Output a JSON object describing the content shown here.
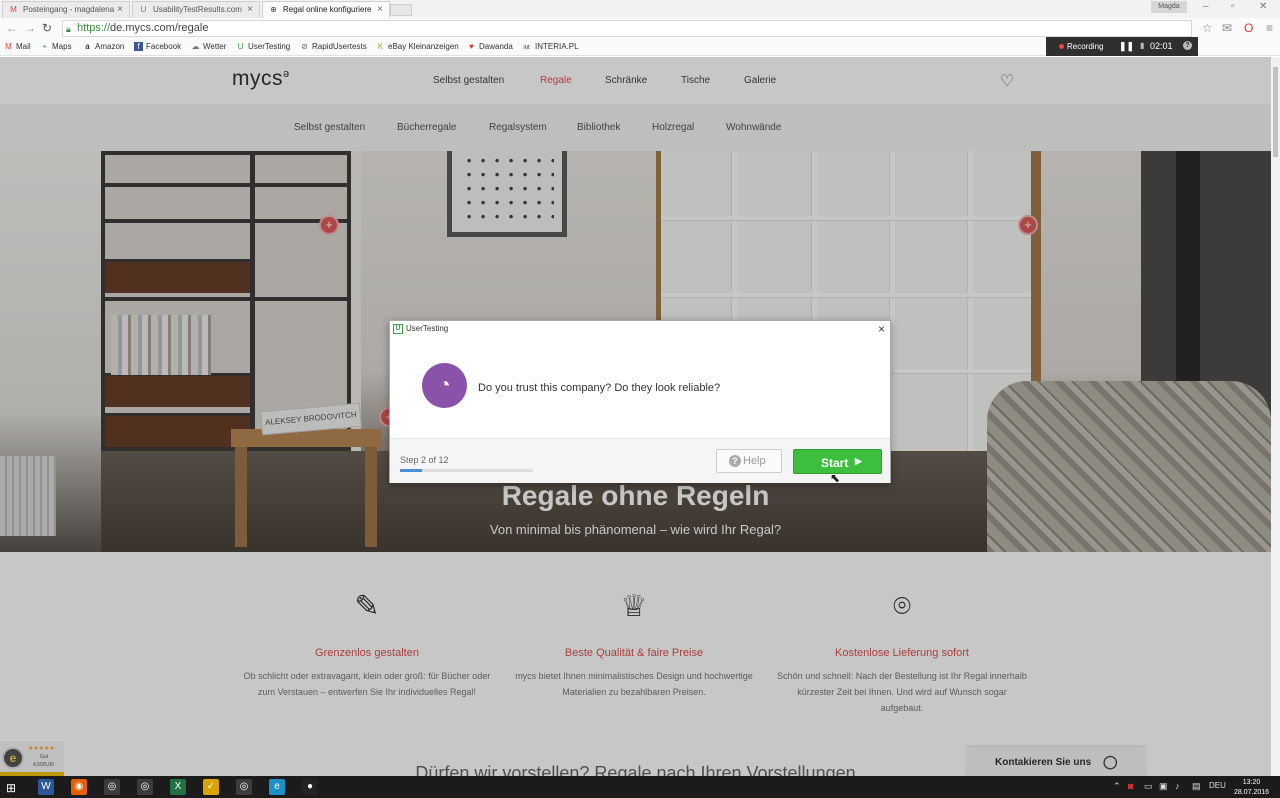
{
  "browser": {
    "tabs": [
      {
        "label": "Posteingang - magdalena",
        "icon": "gmail-icon",
        "icon_char": "M"
      },
      {
        "label": "UsabilityTestResults.com",
        "icon": "usertesting-icon",
        "icon_char": "U"
      },
      {
        "label": "Regal online konfiguriere",
        "icon": "mycs-icon",
        "icon_char": "⊕"
      }
    ],
    "active_tab": 2,
    "window_user": "Magda",
    "url": {
      "scheme": "https://",
      "rest": "de.mycs.com/regale"
    },
    "bookmarks": [
      {
        "label": "Mail",
        "icon": "gmail-icon",
        "icon_char": "M"
      },
      {
        "label": "Maps",
        "icon": "maps-icon",
        "icon_char": "⌖"
      },
      {
        "label": "Amazon",
        "icon": "amazon-icon",
        "icon_char": "a"
      },
      {
        "label": "Facebook",
        "icon": "facebook-icon",
        "icon_char": "f"
      },
      {
        "label": "Wetter",
        "icon": "weather-icon",
        "icon_char": "☁"
      },
      {
        "label": "UserTesting",
        "icon": "usertesting-icon",
        "icon_char": "U"
      },
      {
        "label": "RapidUsertests",
        "icon": "rapidusertests-icon",
        "icon_char": "⊘"
      },
      {
        "label": "eBay Kleinanzeigen",
        "icon": "ebay-icon",
        "icon_char": "K"
      },
      {
        "label": "Dawanda",
        "icon": "dawanda-icon",
        "icon_char": "♥"
      },
      {
        "label": "INTERIA.PL",
        "icon": "interia-icon",
        "icon_char": "int"
      }
    ]
  },
  "recorder": {
    "status": "Recording",
    "time": "02:01"
  },
  "site": {
    "logo": "mycs",
    "nav": [
      {
        "label": "Selbst gestalten"
      },
      {
        "label": "Regale",
        "active": true
      },
      {
        "label": "Schränke"
      },
      {
        "label": "Tische"
      },
      {
        "label": "Galerie"
      }
    ],
    "subnav": [
      "Selbst gestalten",
      "Bücherregale",
      "Regalsystem",
      "Bibliothek",
      "Holzregal",
      "Wohnwände"
    ],
    "hero": {
      "title": "Regale ohne Regeln",
      "subtitle": "Von minimal bis phänomenal – wie wird Ihr Regal?",
      "book_title": "ALEKSEY BRODOVITCH"
    },
    "features": [
      {
        "icon": "pencil-icon",
        "title": "Grenzenlos gestalten",
        "text": "Ob schlicht oder extravagant, klein oder groß: für Bücher oder zum Verstauen – entwerfen Sie Ihr individuelles Regal!"
      },
      {
        "icon": "crown-icon",
        "title": "Beste Qualität & faire Preise",
        "text": "mycs bietet Ihnen minimalistisches Design und hochwertige Materialien zu bezahlbaren Preisen."
      },
      {
        "icon": "location-pin-icon",
        "title": "Kostenlose Lieferung sofort",
        "text": "Schön und schnell: Nach der Bestellung ist Ihr Regal innerhalb kürzester Zeit bei Ihnen. Und wird auf Wunsch sogar aufgebaut."
      }
    ],
    "bottom_heading": "Dürfen wir vorstellen? Regale nach Ihren Vorstellungen",
    "contact_label": "Kontakieren Sie uns",
    "trust_badge": {
      "stars": "★★★★★",
      "value_line1": "Gut",
      "value_line2": "4,50/5,00"
    }
  },
  "dialog": {
    "app_name": "UserTesting",
    "question": "Do you trust this company? Do they look reliable?",
    "step_label": "Step 2 of 12",
    "progress": 0.167,
    "help_label": "Help",
    "start_label": "Start"
  },
  "taskbar": {
    "apps": [
      {
        "icon": "word-icon",
        "char": "W",
        "color": "#2b5797"
      },
      {
        "icon": "firefox-icon",
        "char": "◉",
        "color": "#e66000"
      },
      {
        "icon": "chrome-icon",
        "char": "◎",
        "color": "#3b3b3b"
      },
      {
        "icon": "chrome-icon",
        "char": "◎",
        "color": "#3b3b3b"
      },
      {
        "icon": "excel-icon",
        "char": "X",
        "color": "#207245"
      },
      {
        "icon": "norton-icon",
        "char": "✓",
        "color": "#d9a400"
      },
      {
        "icon": "chrome-icon",
        "char": "◎",
        "color": "#3b3b3b"
      },
      {
        "icon": "ie-icon",
        "char": "e",
        "color": "#1e90c8"
      },
      {
        "icon": "recorder-icon",
        "char": "●",
        "color": "#222"
      }
    ],
    "language": "DEU",
    "time": "13:20",
    "date": "28.07.2016"
  },
  "colors": {
    "accent_red": "#d9534f",
    "start_green": "#3cbf3c",
    "mic_purple": "#8a52a8"
  }
}
